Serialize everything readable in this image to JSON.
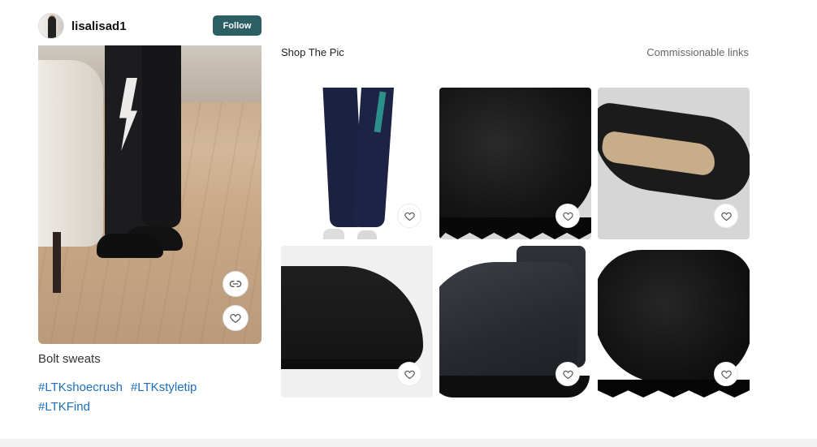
{
  "author": {
    "username": "lisalisad1",
    "follow_label": "Follow"
  },
  "post": {
    "caption": "Bolt sweats",
    "hashtags": [
      "#LTKshoecrush",
      "#LTKstyletip",
      "#LTKFind"
    ],
    "link_icon": "link-icon",
    "heart_icon": "heart-icon"
  },
  "shop": {
    "title": "Shop The Pic",
    "commission_note": "Commissionable links",
    "products": [
      {
        "name": "navy-bolt-sweatpants"
      },
      {
        "name": "black-fur-slide"
      },
      {
        "name": "black-ugg-slipper"
      },
      {
        "name": "black-slip-on-shoe"
      },
      {
        "name": "black-mini-boot"
      },
      {
        "name": "black-fur-slipper"
      }
    ]
  },
  "colors": {
    "follow_button": "#2c5f63",
    "hashtag": "#1d6fb8"
  }
}
